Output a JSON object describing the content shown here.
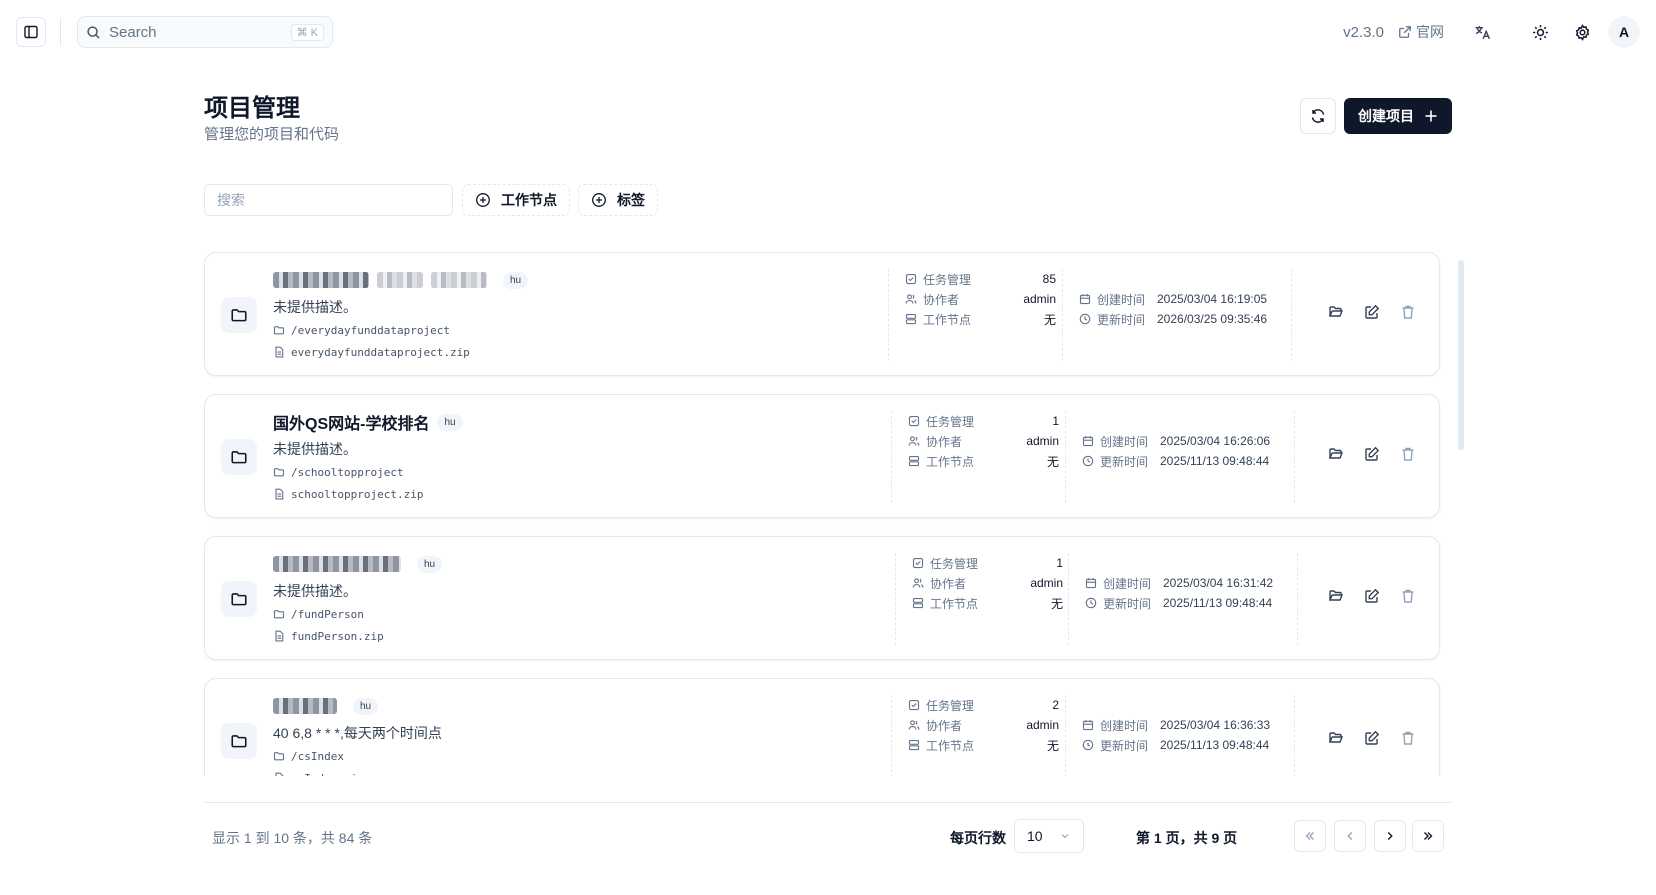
{
  "topbar": {
    "search_label": "Search",
    "search_shortcut": "⌘ K",
    "version": "v2.3.0",
    "site_link": "官网",
    "avatar_initial": "A"
  },
  "header": {
    "title": "项目管理",
    "subtitle": "管理您的项目和代码",
    "create_label": "创建项目"
  },
  "filters": {
    "search_placeholder": "搜索",
    "node_filter": "工作节点",
    "tag_filter": "标签"
  },
  "labels": {
    "tasks": "任务管理",
    "collaborator": "协作者",
    "work_node": "工作节点",
    "created": "创建时间",
    "updated": "更新时间"
  },
  "projects": [
    {
      "name": "",
      "name_obscured": true,
      "tag": "hu",
      "description": "未提供描述。",
      "path": "/everydayfunddataproject",
      "archive": "everydayfunddataproject.zip",
      "tasks": "85",
      "collaborator": "admin",
      "work_node": "无",
      "created": "2025/03/04 16:19:05",
      "updated": "2026/03/25 09:35:46"
    },
    {
      "name": "国外QS网站-学校排名",
      "name_obscured": false,
      "tag": "hu",
      "description": "未提供描述。",
      "path": "/schooltopproject",
      "archive": "schooltopproject.zip",
      "tasks": "1",
      "collaborator": "admin",
      "work_node": "无",
      "created": "2025/03/04 16:26:06",
      "updated": "2025/11/13 09:48:44"
    },
    {
      "name": "",
      "name_obscured": true,
      "tag": "hu",
      "description": "未提供描述。",
      "path": "/fundPerson",
      "archive": "fundPerson.zip",
      "tasks": "1",
      "collaborator": "admin",
      "work_node": "无",
      "created": "2025/03/04 16:31:42",
      "updated": "2025/11/13 09:48:44"
    },
    {
      "name": "",
      "name_obscured": true,
      "tag": "hu",
      "description": "40 6,8 * * *,每天两个时间点",
      "path": "/csIndex",
      "archive": "csIndex.zip",
      "tasks": "2",
      "collaborator": "admin",
      "work_node": "无",
      "created": "2025/03/04 16:36:33",
      "updated": "2025/11/13 09:48:44"
    }
  ],
  "pagination": {
    "range_text": "显示 1 到 10 条，共 84 条",
    "rows_label": "每页行数",
    "rows_value": "10",
    "page_info": "第 1 页，共 9 页"
  }
}
